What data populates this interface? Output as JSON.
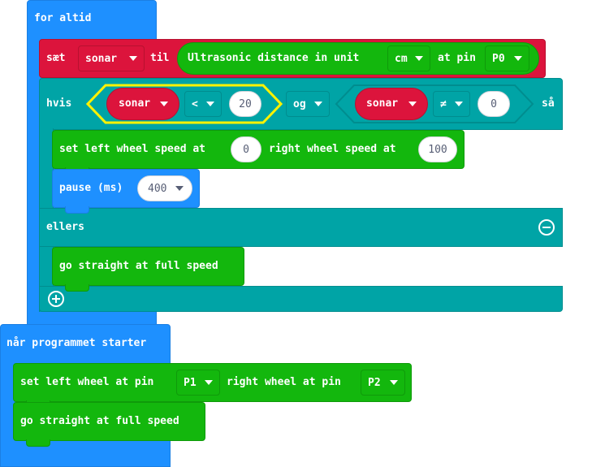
{
  "forever": {
    "label": "for altid",
    "set_block": {
      "label": "sæt",
      "variable": "sonar",
      "to_label": "til",
      "reporter": {
        "label": "Ultrasonic distance in unit",
        "unit": "cm",
        "pin_label": "at pin",
        "pin": "P0"
      }
    },
    "if_block": {
      "if_label": "hvis",
      "then_label": "så",
      "else_label": "ellers",
      "condition_left": {
        "variable": "sonar",
        "operator": "<",
        "value": "20"
      },
      "logic_operator": "og",
      "condition_right": {
        "variable": "sonar",
        "operator": "≠",
        "value": "0"
      },
      "then_blocks": {
        "wheel_speed": {
          "left_label": "set left wheel speed at",
          "left_value": "0",
          "right_label": "right wheel speed at",
          "right_value": "100"
        },
        "pause": {
          "label": "pause (ms)",
          "value": "400"
        }
      },
      "else_blocks": {
        "go_straight": "go straight at full speed"
      },
      "minus_icon": "minus-circle-icon",
      "plus_icon": "plus-circle-icon"
    }
  },
  "on_start": {
    "label": "når programmet starter",
    "set_wheels": {
      "left_label": "set left wheel at pin",
      "left_pin": "P1",
      "right_label": "right wheel at pin",
      "right_pin": "P2"
    },
    "go_straight": "go straight at full speed"
  },
  "colors": {
    "basic": "#1e90ff",
    "variables": "#dc143c",
    "robot": "#13b70d",
    "logic": "#00a4a6",
    "highlight": "#fff200"
  }
}
